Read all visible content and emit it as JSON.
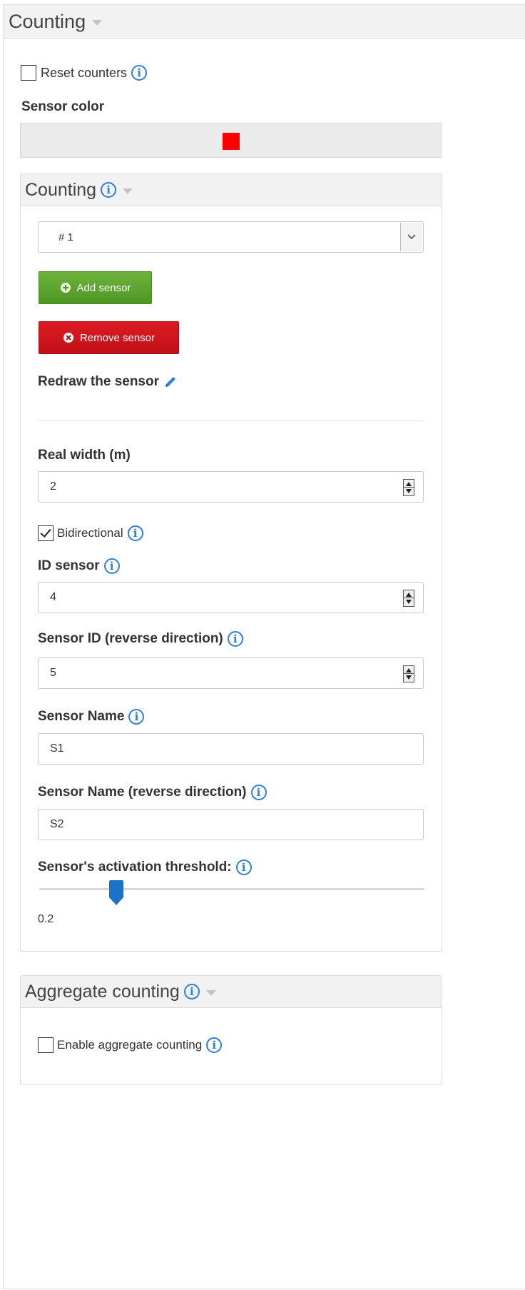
{
  "outer": {
    "title": "Counting",
    "reset_counters_label": "Reset counters",
    "reset_counters_checked": false,
    "sensor_color_label": "Sensor color",
    "sensor_color_value": "#ff0000"
  },
  "counting_panel": {
    "title": "Counting",
    "sensor_select": {
      "selected": "# 1"
    },
    "add_sensor_label": "Add sensor",
    "remove_sensor_label": "Remove sensor",
    "redraw_label": "Redraw the sensor",
    "real_width_label": "Real width (m)",
    "real_width_value": "2",
    "bidirectional_label": "Bidirectional",
    "bidirectional_checked": true,
    "id_sensor_label": "ID sensor",
    "id_sensor_value": "4",
    "sensor_id_reverse_label": "Sensor ID (reverse direction)",
    "sensor_id_reverse_value": "5",
    "sensor_name_label": "Sensor Name",
    "sensor_name_value": "S1",
    "sensor_name_reverse_label": "Sensor Name (reverse direction)",
    "sensor_name_reverse_value": "S2",
    "threshold_label": "Sensor's activation threshold:",
    "threshold_value": "0.2",
    "threshold_fraction": 0.2
  },
  "aggregate_panel": {
    "title": "Aggregate counting",
    "enable_label": "Enable aggregate counting",
    "enable_checked": false
  },
  "colors": {
    "accent": "#2e7fd6",
    "add_button": "#5fa32e",
    "remove_button": "#d0151d",
    "slider_handle": "#1a73c9"
  },
  "icons": {
    "info": "info-icon",
    "pencil": "pencil-icon",
    "plus": "plus-circle-icon",
    "remove": "x-circle-icon",
    "caret": "caret-down-icon"
  }
}
